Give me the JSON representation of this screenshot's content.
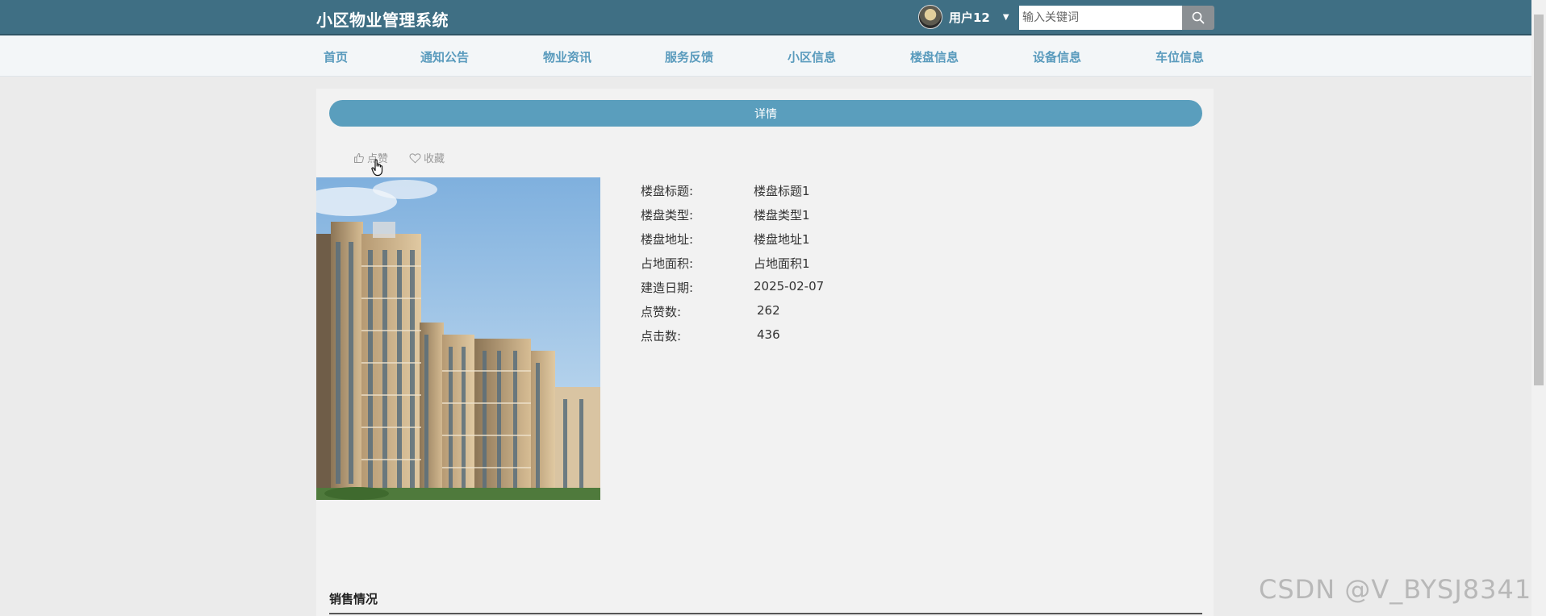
{
  "header": {
    "title": "小区物业管理系统",
    "user_name": "用户12",
    "search_placeholder": "输入关键词"
  },
  "nav": {
    "items": [
      {
        "label": "首页"
      },
      {
        "label": "通知公告"
      },
      {
        "label": "物业资讯"
      },
      {
        "label": "服务反馈"
      },
      {
        "label": "小区信息"
      },
      {
        "label": "楼盘信息"
      },
      {
        "label": "设备信息"
      },
      {
        "label": "车位信息"
      }
    ]
  },
  "detail": {
    "banner_label": "详情",
    "like_label": "点赞",
    "favorite_label": "收藏",
    "fields": [
      {
        "label": "楼盘标题:",
        "value": "楼盘标题1"
      },
      {
        "label": "楼盘类型:",
        "value": "楼盘类型1"
      },
      {
        "label": "楼盘地址:",
        "value": "楼盘地址1"
      },
      {
        "label": "占地面积:",
        "value": "占地面积1"
      },
      {
        "label": "建造日期:",
        "value": "2025-02-07"
      },
      {
        "label": "点赞数:",
        "value": "262"
      },
      {
        "label": "点击数:",
        "value": "436"
      }
    ]
  },
  "sales": {
    "title": "销售情况"
  },
  "watermark": "CSDN @V_BYSJ8341",
  "colors": {
    "header_bg": "#3f6f84",
    "nav_text": "#5a9bbd",
    "accent": "#5a9ebd"
  },
  "icons": {
    "search": "search-icon",
    "like": "thumb-up-icon",
    "favorite": "heart-icon",
    "caret": "caret-down-icon",
    "cursor": "hand-pointer-icon"
  }
}
